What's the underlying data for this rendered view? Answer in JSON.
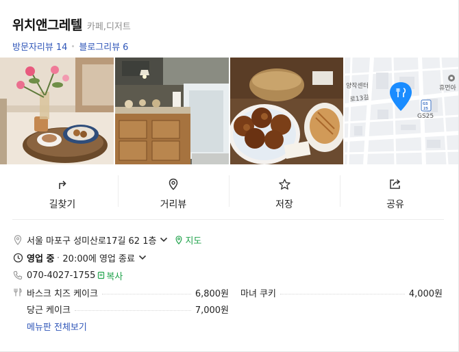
{
  "place": {
    "name": "위치앤그레텔",
    "category": "카페,디저트"
  },
  "reviews": {
    "visitor_label": "방문자리뷰",
    "visitor_count": "14",
    "blog_label": "블로그리뷰",
    "blog_count": "6"
  },
  "map_thumb": {
    "labels": [
      "양작센터",
      "휴먼아",
      "로13길",
      "GS25"
    ],
    "badge": "GS 25"
  },
  "actions": [
    {
      "label": "길찾기",
      "icon": "directions-icon"
    },
    {
      "label": "거리뷰",
      "icon": "streetview-pin-icon"
    },
    {
      "label": "저장",
      "icon": "star-icon"
    },
    {
      "label": "공유",
      "icon": "share-icon"
    }
  ],
  "info": {
    "address": "서울 마포구 성미산로17길 62 1층",
    "map_link": "지도",
    "status": "영업 중",
    "hours": "20:00에 영업 종료",
    "phone": "070-4027-1755",
    "copy_label": "복사"
  },
  "menu": {
    "items": [
      {
        "name": "바스크 치즈 케이크",
        "price": "6,800원"
      },
      {
        "name": "마녀 쿠키",
        "price": "4,000원"
      },
      {
        "name": "당근 케이크",
        "price": "7,000원"
      }
    ],
    "more_label": "메뉴판 전체보기"
  },
  "colors": {
    "link_blue": "#2e55b8",
    "green": "#1fa24a",
    "map_pin": "#1a8cff"
  }
}
